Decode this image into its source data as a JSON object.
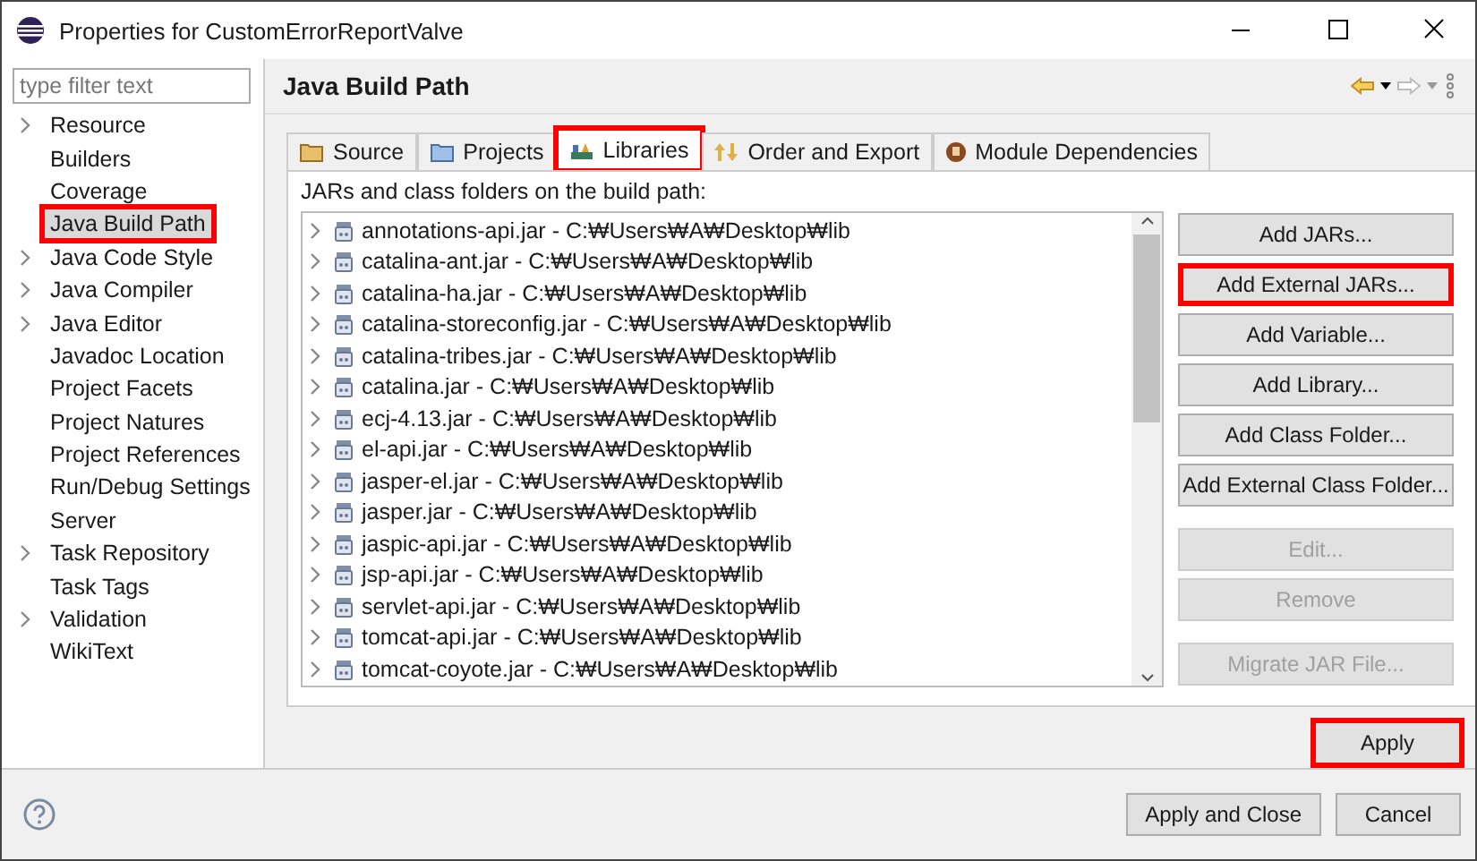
{
  "window": {
    "title": "Properties for CustomErrorReportValve"
  },
  "filter": {
    "placeholder": "type filter text"
  },
  "sidebar": {
    "items": [
      {
        "label": "Resource",
        "collapsible": true,
        "selected": false,
        "highlighted": false
      },
      {
        "label": "Builders",
        "collapsible": false,
        "selected": false,
        "highlighted": false
      },
      {
        "label": "Coverage",
        "collapsible": false,
        "selected": false,
        "highlighted": false
      },
      {
        "label": "Java Build Path",
        "collapsible": false,
        "selected": true,
        "highlighted": true
      },
      {
        "label": "Java Code Style",
        "collapsible": true,
        "selected": false,
        "highlighted": false
      },
      {
        "label": "Java Compiler",
        "collapsible": true,
        "selected": false,
        "highlighted": false
      },
      {
        "label": "Java Editor",
        "collapsible": true,
        "selected": false,
        "highlighted": false
      },
      {
        "label": "Javadoc Location",
        "collapsible": false,
        "selected": false,
        "highlighted": false
      },
      {
        "label": "Project Facets",
        "collapsible": false,
        "selected": false,
        "highlighted": false
      },
      {
        "label": "Project Natures",
        "collapsible": false,
        "selected": false,
        "highlighted": false
      },
      {
        "label": "Project References",
        "collapsible": false,
        "selected": false,
        "highlighted": false
      },
      {
        "label": "Run/Debug Settings",
        "collapsible": false,
        "selected": false,
        "highlighted": false
      },
      {
        "label": "Server",
        "collapsible": false,
        "selected": false,
        "highlighted": false
      },
      {
        "label": "Task Repository",
        "collapsible": true,
        "selected": false,
        "highlighted": false
      },
      {
        "label": "Task Tags",
        "collapsible": false,
        "selected": false,
        "highlighted": false
      },
      {
        "label": "Validation",
        "collapsible": true,
        "selected": false,
        "highlighted": false
      },
      {
        "label": "WikiText",
        "collapsible": false,
        "selected": false,
        "highlighted": false
      }
    ]
  },
  "page": {
    "title": "Java Build Path"
  },
  "tabs": [
    {
      "label": "Source",
      "kind": "source",
      "selected": false,
      "highlighted": false
    },
    {
      "label": "Projects",
      "kind": "projects",
      "selected": false,
      "highlighted": false
    },
    {
      "label": "Libraries",
      "kind": "libraries",
      "selected": true,
      "highlighted": true
    },
    {
      "label": "Order and Export",
      "kind": "order",
      "selected": false,
      "highlighted": false
    },
    {
      "label": "Module Dependencies",
      "kind": "module",
      "selected": false,
      "highlighted": false
    }
  ],
  "list": {
    "caption": "JARs and class folders on the build path:",
    "items": [
      "annotations-api.jar - C:₩Users₩A₩Desktop₩lib",
      "catalina-ant.jar - C:₩Users₩A₩Desktop₩lib",
      "catalina-ha.jar - C:₩Users₩A₩Desktop₩lib",
      "catalina-storeconfig.jar - C:₩Users₩A₩Desktop₩lib",
      "catalina-tribes.jar - C:₩Users₩A₩Desktop₩lib",
      "catalina.jar - C:₩Users₩A₩Desktop₩lib",
      "ecj-4.13.jar - C:₩Users₩A₩Desktop₩lib",
      "el-api.jar - C:₩Users₩A₩Desktop₩lib",
      "jasper-el.jar - C:₩Users₩A₩Desktop₩lib",
      "jasper.jar - C:₩Users₩A₩Desktop₩lib",
      "jaspic-api.jar - C:₩Users₩A₩Desktop₩lib",
      "jsp-api.jar - C:₩Users₩A₩Desktop₩lib",
      "servlet-api.jar - C:₩Users₩A₩Desktop₩lib",
      "tomcat-api.jar - C:₩Users₩A₩Desktop₩lib",
      "tomcat-coyote.jar - C:₩Users₩A₩Desktop₩lib"
    ]
  },
  "button_groups": [
    [
      {
        "label": "Add JARs...",
        "disabled": false,
        "highlighted": false
      },
      {
        "label": "Add External JARs...",
        "disabled": false,
        "highlighted": true
      },
      {
        "label": "Add Variable...",
        "disabled": false,
        "highlighted": false
      },
      {
        "label": "Add Library...",
        "disabled": false,
        "highlighted": false
      },
      {
        "label": "Add Class Folder...",
        "disabled": false,
        "highlighted": false
      },
      {
        "label": "Add External Class Folder...",
        "disabled": false,
        "highlighted": false
      }
    ],
    [
      {
        "label": "Edit...",
        "disabled": true,
        "highlighted": false
      },
      {
        "label": "Remove",
        "disabled": true,
        "highlighted": false
      }
    ],
    [
      {
        "label": "Migrate JAR File...",
        "disabled": true,
        "highlighted": false
      }
    ]
  ],
  "apply": {
    "label": "Apply",
    "highlighted": true
  },
  "footer": {
    "buttons": [
      {
        "label": "Apply and Close"
      },
      {
        "label": "Cancel"
      }
    ]
  }
}
